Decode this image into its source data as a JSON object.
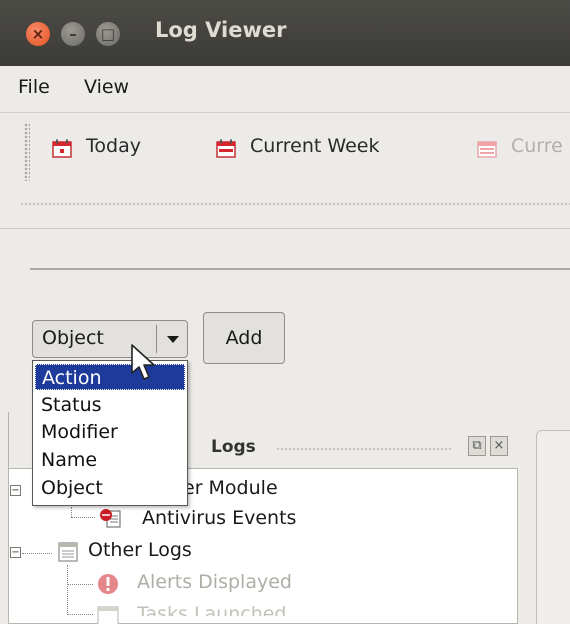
{
  "window": {
    "title": "Log Viewer"
  },
  "menu": {
    "file": "File",
    "view": "View"
  },
  "toolbar": {
    "today": "Today",
    "current_week": "Current Week",
    "current_month_partial": "Curre"
  },
  "filter": {
    "combo_value": "Object",
    "add_label": "Add",
    "options": [
      "Action",
      "Status",
      "Modifier",
      "Name",
      "Object"
    ],
    "selected_option": "Action"
  },
  "logs_pane": {
    "title": "Logs",
    "tree": {
      "module_partial": "er Module",
      "antivirus_events": "Antivirus Events",
      "other_logs": "Other Logs",
      "alerts_displayed": "Alerts Displayed",
      "tasks_partial": "Tasks Launched"
    }
  },
  "colors": {
    "titlebar": "#3c3b37",
    "selection": "#1e3a9a",
    "close_button": "#e2531f"
  }
}
